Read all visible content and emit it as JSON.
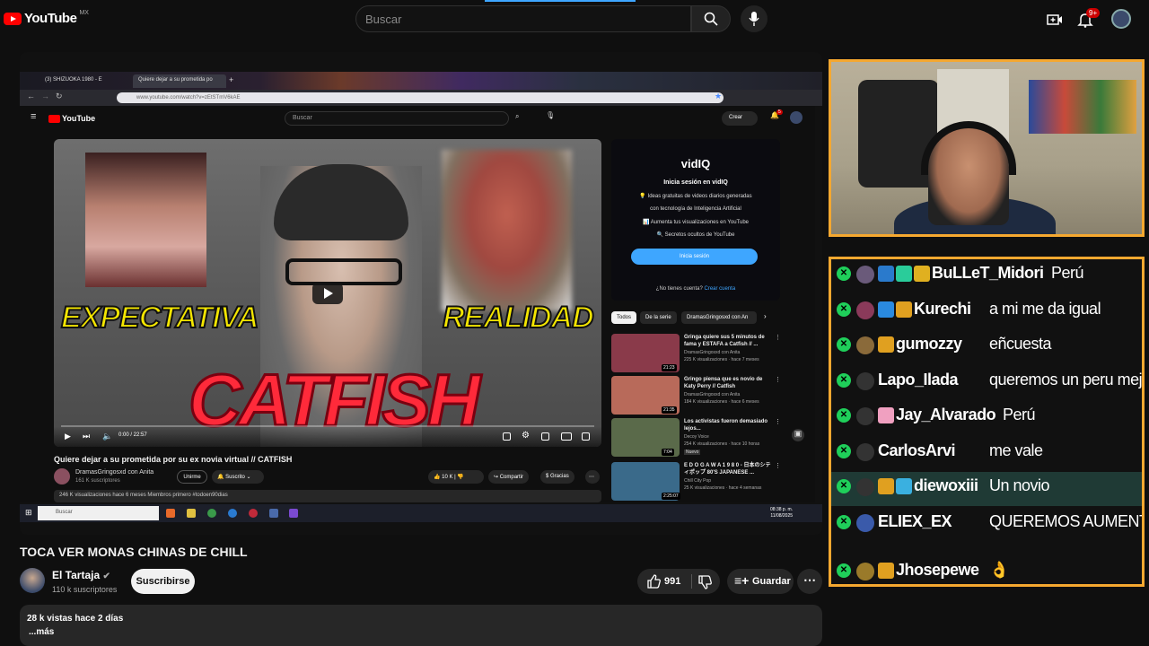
{
  "topbar": {
    "logo": "YouTube",
    "country": "MX",
    "search_placeholder": "Buscar",
    "notifications_badge": "9+"
  },
  "embedded": {
    "tabs": [
      {
        "label": "(3) SHIZUOKA 1980 - E"
      },
      {
        "label": "Quiere dejar a su prometida po"
      }
    ],
    "url": "www.youtube.com/watch?v=zEtSTmV6kAE",
    "inner_yt": {
      "search_placeholder": "Buscar",
      "crear_label": "Crear",
      "notif_badge": "5"
    },
    "video": {
      "overlay_left": "EXPECTATIVA",
      "overlay_right": "REALIDAD",
      "overlay_main": "CATFISH",
      "time": "0:00 / 22:57",
      "title": "Quiere dejar a su prometida por su ex novia virtual // CATFISH",
      "channel": "DramasGringosxd con Anita",
      "subs": "161 K suscriptores",
      "unirme": "Unirme",
      "suscrito": "Suscrito",
      "likes": "10 K",
      "compartir": "Compartir",
      "gracias": "Gracias",
      "desc": "246 K visualizaciones  hace 6 meses  Miembros primero  #todoen90dias"
    },
    "vidiq": {
      "logo": "vidIQ",
      "heading": "Inicia sesión en vidIQ",
      "b1": "💡 Ideas gratuitas de videos diarios generadas",
      "b1b": "con tecnología de Inteligencia Artificial",
      "b2": "📊 Aumenta tus visualizaciones en YouTube",
      "b3": "🔍 Secretos ocultos de YouTube",
      "button": "Inicia sesión",
      "no_account": "¿No tienes cuenta?",
      "create": "Crear cuenta"
    },
    "chips": [
      "Todos",
      "De la serie",
      "DramasGringosxd con An"
    ],
    "recommendations": [
      {
        "title": "Gringa quiere sus 5 minutos de fama y ESTAFA a Catfish // ...",
        "channel": "DramasGringosxd con Anita",
        "meta": "225 K visualizaciones · hace 7 meses",
        "duration": "21:23",
        "thumb": "#8a3a4a"
      },
      {
        "title": "Gringo piensa que es novio de Katy Perry // Catfish",
        "channel": "DramasGringosxd con Anita",
        "meta": "184 K visualizaciones · hace 6 meses",
        "duration": "21:35",
        "thumb": "#b86a5a"
      },
      {
        "title": "Los activistas fueron demasiado lejos...",
        "channel": "Decoy Voice",
        "meta": "254 K visualizaciones · hace 10 horas",
        "badge": "Nuevo",
        "duration": "7:04",
        "thumb": "#5a6a4a"
      },
      {
        "title": "E D O G A W A  1 9 8 0 - 日本のシティポップ 80'S JAPANESE ...",
        "channel": "Chill City Pop",
        "meta": "25 K visualizaciones · hace 4 semanas",
        "duration": "2:25:07",
        "thumb": "#3a6a8a"
      }
    ],
    "taskbar": {
      "search": "Buscar",
      "time": "08:38 p. m.",
      "date": "11/08/2025"
    }
  },
  "main": {
    "title": "TOCA VER MONAS CHINAS DE CHILL",
    "channel": "El Tartaja",
    "subs": "110 k suscriptores",
    "subscribe": "Suscribirse",
    "likes": "991",
    "save": "Guardar",
    "views_line": "28 k vistas  hace 2 días",
    "more": "...más"
  },
  "chat": {
    "messages": [
      {
        "user": "BuLLeT_Midori",
        "text": "Perú",
        "badges": [
          "#2a7acc",
          "#2acc9a",
          "#e0b020"
        ],
        "avatar": "#6a5a7a",
        "user_color": "#ffffff"
      },
      {
        "user": "Kurechi",
        "text": "a mi me da igual",
        "badges": [
          "#2a8ae0",
          "#e0a020"
        ],
        "avatar": "#8a3a5a",
        "user_color": "#ffffff"
      },
      {
        "user": "gumozzy",
        "text": "eñcuesta",
        "badges": [
          "#e0a020"
        ],
        "avatar": "#8a6a3a",
        "user_color": "#ffffff"
      },
      {
        "user": "Lapo_Ilada",
        "text": "queremos un peru mejor",
        "badges": [],
        "avatar": "#333333",
        "user_color": "#ffffff"
      },
      {
        "user": "Jay_Alvarado",
        "text": "Perú",
        "badges": [
          "#f0a0c0"
        ],
        "avatar": "#333333",
        "user_color": "#ffffff"
      },
      {
        "user": "CarlosArvi",
        "text": "me vale",
        "badges": [],
        "avatar": "#333333",
        "user_color": "#ffffff"
      },
      {
        "user": "diewoxiii",
        "text": "Un novio",
        "badges": [
          "#e0a020",
          "#3ab0e0"
        ],
        "avatar": "#333333",
        "user_color": "#ffffff",
        "highlight": true
      },
      {
        "user": "ELIEX_EX",
        "text": "QUEREMOS AUMENTOS",
        "badges": [],
        "avatar": "#3a5aaa",
        "user_color": "#ffffff"
      },
      {
        "user": "Jhosepewe",
        "text": "👌",
        "badges": [
          "#e0a020"
        ],
        "avatar": "#9a7a2a",
        "user_color": "#ffffff"
      }
    ]
  },
  "colors": {
    "accent": "#3ea6ff",
    "frame": "#f5a830",
    "mod": "#1fcf5a",
    "brand": "#ff0000"
  }
}
